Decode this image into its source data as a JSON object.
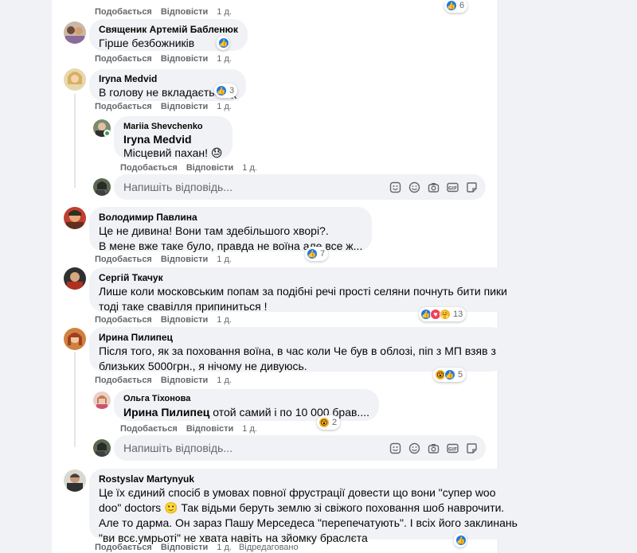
{
  "actions": {
    "like": "Подобається",
    "reply": "Відповісти",
    "time": "1 д.",
    "edited": "Відредаговано"
  },
  "reply_placeholder": "Напишіть відповідь...",
  "top_row": {
    "count": "6"
  },
  "comments": [
    {
      "author": "Священик Артемій Бабленюк",
      "lines": [
        "Гірше безбожників"
      ]
    },
    {
      "author": "Iryna Medvid",
      "lines": [
        "В голову не вкладається (("
      ],
      "reactions": "3"
    },
    {
      "author": "Mariia Shevchenko",
      "mention": "Iryna Medvid",
      "lines": [
        "Місцевий пахан! 😓"
      ]
    },
    {
      "author": "Володимир Павлина",
      "lines": [
        "Це не дивина! Вони там здебільшого хворі?.",
        "В мене вже таке було, правда не воїна але все ж..."
      ],
      "reactions": "7"
    },
    {
      "author": "Сергій Ткачук",
      "lines": [
        "Лише коли московським попам за подібні речі прості селяни почнуть бити пики",
        "тоді таке свавілля припиниться !"
      ],
      "reactions": "13"
    },
    {
      "author": "Ирина Пилипец",
      "lines": [
        "Після того, як за поховання воїна, в час коли Че був в облозі, піп з МП взяв з",
        "близьких 5000грн., я нічому не дивуюсь."
      ],
      "reactions": "5"
    },
    {
      "author": "Ольга Тіхонова",
      "mention": "Ирина Пилипец",
      "lines": [
        "отой самий і по 10 000 брав...."
      ],
      "reactions": "2"
    },
    {
      "author": "Rostyslav Martynyuk",
      "lines": [
        "Це їх єдиний спосіб в умовах повної фрустрації довести що вони \"супер woo",
        "doo\" doctors 🙂 Так відьми беруть землю зі свіжого поховання шоб наврочити.",
        "Але то дарма. Он зараз Пашу Мерседеса \"перепечатують\". І всіх його заклинань",
        "\"ви всє.умрьоті\" не хвата навіть на зйомку браслєта"
      ]
    }
  ]
}
